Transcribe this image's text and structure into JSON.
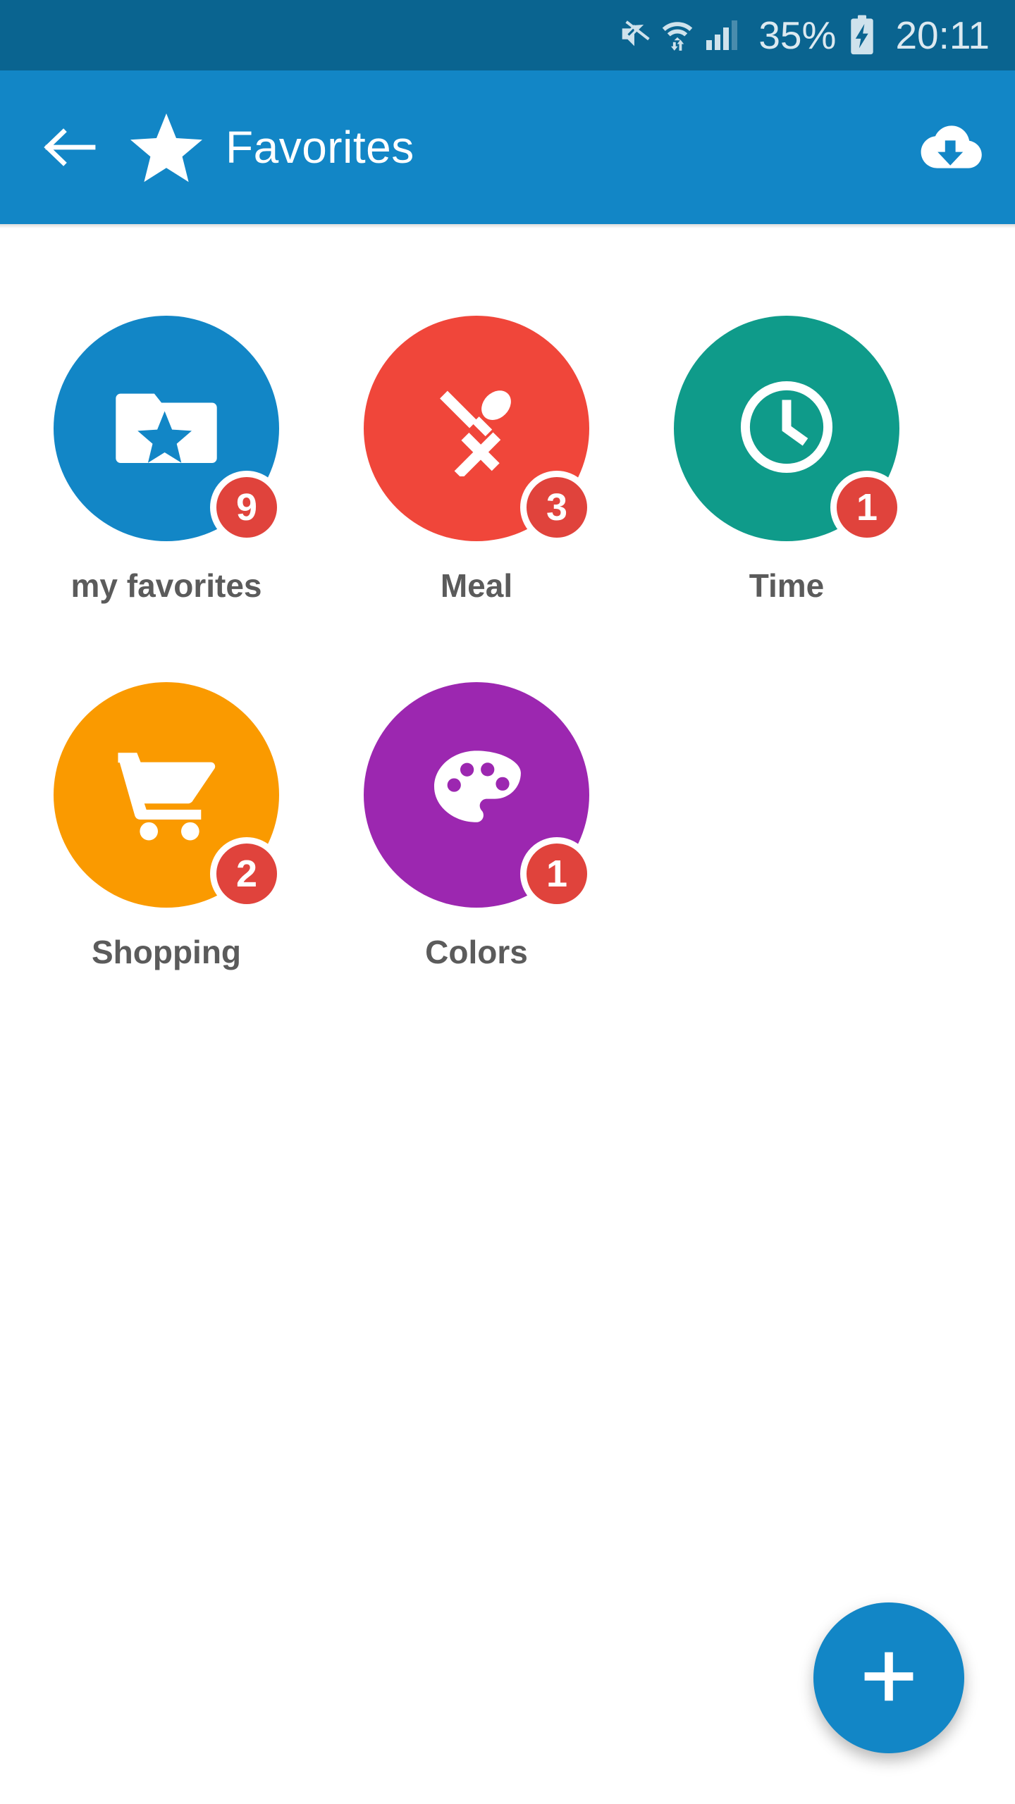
{
  "status_bar": {
    "background": "#0a6490",
    "icons": [
      "mute-icon",
      "wifi-icon",
      "signal-icon",
      "battery-charging-icon"
    ],
    "battery_percent": "35%",
    "time": "20:11"
  },
  "app_bar": {
    "background": "#1286c6",
    "back_icon": "arrow-left-icon",
    "leading_icon": "star-icon",
    "title": "Favorites",
    "action_icon": "cloud-download-icon"
  },
  "categories": [
    {
      "label": "my favorites",
      "badge": "9",
      "color": "#1286c6",
      "icon": "folder-star-icon"
    },
    {
      "label": "Meal",
      "badge": "3",
      "color": "#f0463a",
      "icon": "cutlery-icon"
    },
    {
      "label": "Time",
      "badge": "1",
      "color": "#0f9b8a",
      "icon": "clock-icon"
    },
    {
      "label": "Shopping",
      "badge": "2",
      "color": "#fa9a00",
      "icon": "shopping-cart-icon"
    },
    {
      "label": "Colors",
      "badge": "1",
      "color": "#9c27b0",
      "icon": "palette-icon"
    }
  ],
  "fab": {
    "icon": "plus-icon",
    "color": "#1286c6"
  },
  "theme": {
    "badge_color": "#e0433c",
    "label_color": "#5b5b5b",
    "page_background": "#ffffff"
  }
}
